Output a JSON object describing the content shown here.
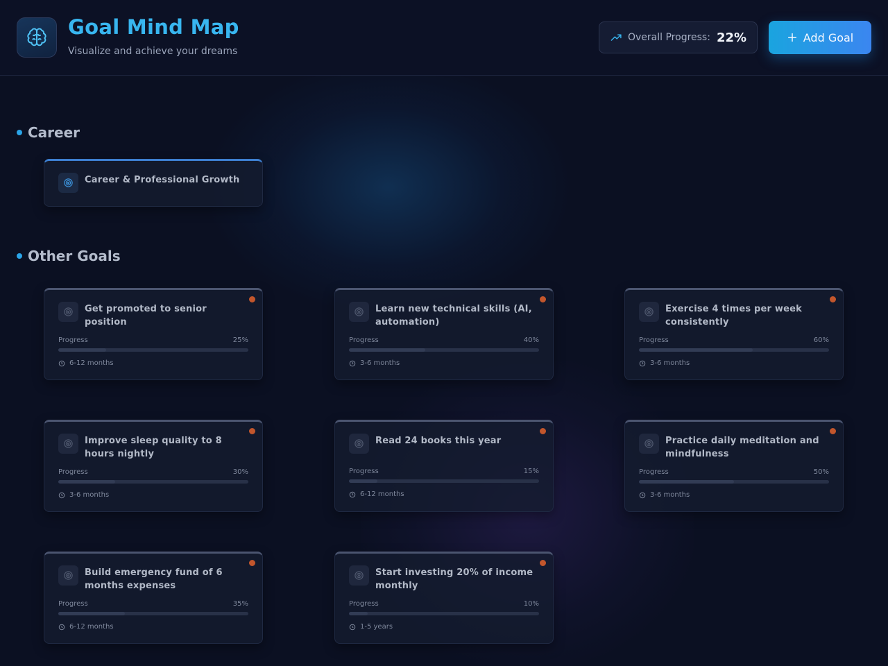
{
  "header": {
    "title": "Goal Mind Map",
    "subtitle": "Visualize and achieve your dreams",
    "logo_icon": "brain-icon",
    "progress_label": "Overall Progress:",
    "progress_value": "22%",
    "progress_icon": "trending-up-icon",
    "add_button_label": "Add Goal",
    "add_button_icon": "plus-icon"
  },
  "colors": {
    "accent": "#38b6f0",
    "background": "#0b1022",
    "button_gradient_start": "#1aa4df",
    "button_gradient_end": "#3b86f0",
    "status_dot": "#c2562c",
    "career_border": "#3d7fd0"
  },
  "sections": [
    {
      "title": "Career",
      "cards": [
        {
          "title": "Career & Professional Growth",
          "icon": "target-icon"
        }
      ]
    },
    {
      "title": "Other Goals",
      "cards": [
        {
          "title": "Get promoted to senior position",
          "progress_label": "Progress",
          "progress": "25%",
          "progress_fraction": 0.25,
          "timeframe": "6-12 months",
          "icon": "target-icon"
        },
        {
          "title": "Learn new technical skills (AI, automation)",
          "progress_label": "Progress",
          "progress": "40%",
          "progress_fraction": 0.4,
          "timeframe": "3-6 months",
          "icon": "target-icon"
        },
        {
          "title": "Exercise 4 times per week consistently",
          "progress_label": "Progress",
          "progress": "60%",
          "progress_fraction": 0.6,
          "timeframe": "3-6 months",
          "icon": "target-icon"
        },
        {
          "title": "Improve sleep quality to 8 hours nightly",
          "progress_label": "Progress",
          "progress": "30%",
          "progress_fraction": 0.3,
          "timeframe": "3-6 months",
          "icon": "target-icon"
        },
        {
          "title": "Read 24 books this year",
          "progress_label": "Progress",
          "progress": "15%",
          "progress_fraction": 0.15,
          "timeframe": "6-12 months",
          "icon": "target-icon"
        },
        {
          "title": "Practice daily meditation and mindfulness",
          "progress_label": "Progress",
          "progress": "50%",
          "progress_fraction": 0.5,
          "timeframe": "3-6 months",
          "icon": "target-icon"
        },
        {
          "title": "Build emergency fund of 6 months expenses",
          "progress_label": "Progress",
          "progress": "35%",
          "progress_fraction": 0.35,
          "timeframe": "6-12 months",
          "icon": "target-icon"
        },
        {
          "title": "Start investing 20% of income monthly",
          "progress_label": "Progress",
          "progress": "10%",
          "progress_fraction": 0.1,
          "timeframe": "1-5 years",
          "icon": "target-icon"
        }
      ]
    }
  ]
}
